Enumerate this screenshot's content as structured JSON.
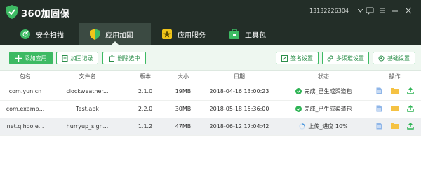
{
  "app": {
    "title": "360加固保",
    "account": "13132226304"
  },
  "window_icons": [
    "feedback-icon",
    "menu-icon",
    "minimize-icon",
    "close-icon"
  ],
  "tabs": [
    {
      "label": "安全扫描",
      "icon": "scan-icon",
      "active": false
    },
    {
      "label": "应用加固",
      "icon": "shield-icon",
      "active": true
    },
    {
      "label": "应用服务",
      "icon": "star-icon",
      "active": false
    },
    {
      "label": "工具包",
      "icon": "toolbox-icon",
      "active": false
    }
  ],
  "toolbar": {
    "add": "添加应用",
    "log": "加固记录",
    "delete": "删除选中",
    "signature": "签名设置",
    "multichannel": "多渠道设置",
    "basic": "基础设置"
  },
  "table": {
    "headers": [
      "包名",
      "文件名",
      "版本",
      "大小",
      "日期",
      "状态",
      "操作"
    ],
    "rows": [
      {
        "pkg": "com.yun.cn",
        "file": "clockweather...",
        "version": "2.1.0",
        "size": "19MB",
        "date": "2018-04-16 13:00:23",
        "status": "完成_已生成渠道包",
        "state": "done"
      },
      {
        "pkg": "com.examp...",
        "file": "Test.apk",
        "version": "2.2.0",
        "size": "30MB",
        "date": "2018-05-18 15:36:00",
        "status": "完成_已生成渠道包",
        "state": "done"
      },
      {
        "pkg": "net.qihoo.e...",
        "file": "hurryup_sign...",
        "version": "1.1.2",
        "size": "47MB",
        "date": "2018-06-12 17:04:42",
        "status": "上传_进度 10%",
        "state": "uploading"
      }
    ]
  },
  "colors": {
    "accent": "#3dba63",
    "titlebar": "#232e28",
    "toolbar_bg": "#eef7f0",
    "status_ok": "#2fb455",
    "status_loading": "#3c8fdc",
    "folder": "#f5c243"
  }
}
